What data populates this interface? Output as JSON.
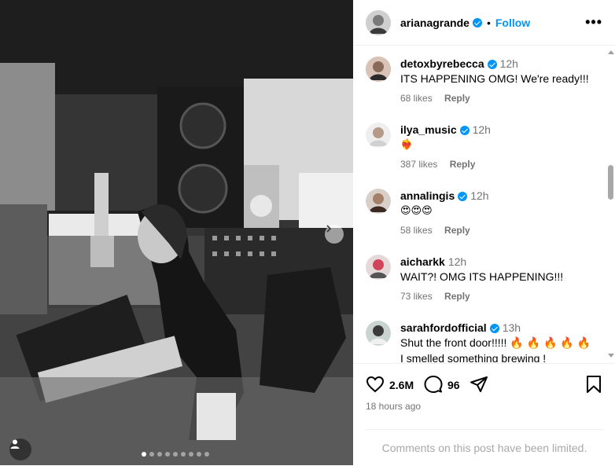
{
  "header": {
    "username": "arianagrande",
    "separator": "•",
    "follow_label": "Follow",
    "more_label": "•••"
  },
  "carousel": {
    "total_slides": 9,
    "active_slide": 1
  },
  "comments": [
    {
      "username": "detoxbyrebecca",
      "verified": true,
      "time": "12h",
      "text": "ITS HAPPENING OMG! We're ready!!!",
      "likes": "68 likes",
      "reply": "Reply"
    },
    {
      "username": "ilya_music",
      "verified": true,
      "time": "12h",
      "text": "❤️‍🔥",
      "likes": "387 likes",
      "reply": "Reply"
    },
    {
      "username": "annalingis",
      "verified": true,
      "time": "12h",
      "text": "😍😍😍",
      "likes": "58 likes",
      "reply": "Reply"
    },
    {
      "username": "aicharkk",
      "verified": false,
      "time": "12h",
      "text": "WAIT?! OMG ITS HAPPENING!!!",
      "likes": "73 likes",
      "reply": "Reply"
    },
    {
      "username": "sarahfordofficial",
      "verified": true,
      "time": "13h",
      "text": "Shut the front door!!!!! 🔥 🔥 🔥 🔥 🔥",
      "text2": "I smelled something brewing !",
      "likes": "",
      "reply": ""
    }
  ],
  "actions": {
    "likes_count": "2.6M",
    "comments_count": "96",
    "posted_time": "18 hours ago"
  },
  "footer": {
    "limited_text": "Comments on this post have been limited."
  },
  "icons": {
    "like": "heart-icon",
    "comment": "comment-bubble-icon",
    "share": "paper-plane-icon",
    "save": "bookmark-icon"
  },
  "colors": {
    "accent": "#0095f6",
    "muted": "#737373",
    "limited": "#a8a8a8"
  }
}
